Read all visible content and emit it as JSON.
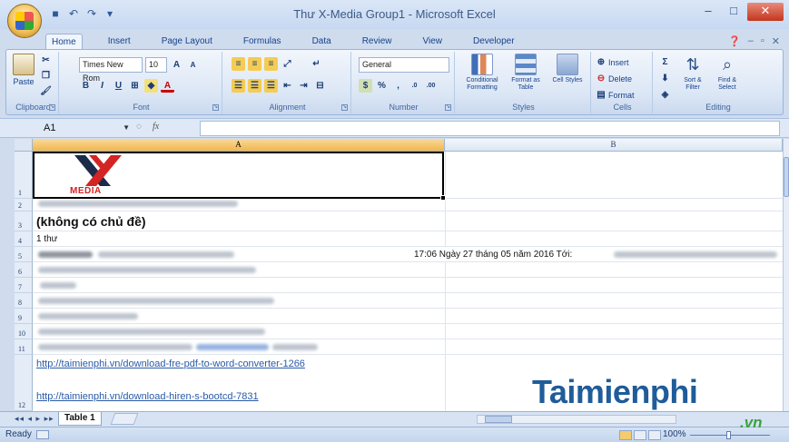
{
  "window": {
    "title": "Thư X-Media Group1 - Microsoft Excel",
    "minimize": "–",
    "maximize": "□",
    "close": "✕"
  },
  "tabs": [
    "Home",
    "Insert",
    "Page Layout",
    "Formulas",
    "Data",
    "Review",
    "View",
    "Developer"
  ],
  "ribbon": {
    "clipboard": {
      "label": "Clipboard",
      "paste": "Paste"
    },
    "font": {
      "label": "Font",
      "font_name": "Times New Rom",
      "font_size": "10",
      "bold": "B",
      "italic": "I",
      "underline": "U"
    },
    "alignment": {
      "label": "Alignment"
    },
    "number": {
      "label": "Number",
      "format": "General",
      "percent": "%",
      "comma": ","
    },
    "styles": {
      "label": "Styles",
      "conditional": "Conditional Formatting",
      "format_table": "Format as Table",
      "cell_styles": "Cell Styles"
    },
    "cells": {
      "label": "Cells",
      "insert": "Insert",
      "delete": "Delete",
      "format": "Format"
    },
    "editing": {
      "label": "Editing",
      "sort": "Sort & Filter",
      "find": "Find & Select"
    }
  },
  "formula_bar": {
    "name_box": "A1",
    "fx": "fx"
  },
  "columns": [
    "A",
    "B"
  ],
  "rows": [
    {
      "num": "1"
    },
    {
      "num": "2"
    },
    {
      "num": "3",
      "text": "(không có chủ đề)"
    },
    {
      "num": "4",
      "text": "1 thư"
    },
    {
      "num": "5",
      "text_b": "17:06 Ngày 27 tháng 05 năm 2016 Tới:"
    },
    {
      "num": "6"
    },
    {
      "num": "7"
    },
    {
      "num": "8"
    },
    {
      "num": "9"
    },
    {
      "num": "10"
    },
    {
      "num": "11"
    },
    {
      "num": "12",
      "link1": "http://taimienphi.vn/download-fre-pdf-to-word-converter-1266",
      "link2": "http://taimienphi.vn/download-hiren-s-bootcd-7831"
    }
  ],
  "logo_text": "MEDIA",
  "sheet": {
    "nav": "◂◂ ◂ ▸ ▸▸",
    "tab": "Table 1"
  },
  "status": {
    "ready": "Ready",
    "zoom": "100%"
  },
  "watermark": {
    "main": "Taimienphi",
    "sub": ".vn"
  },
  "colors": {
    "logo_red": "#d42424",
    "logo_dark": "#1d2b4a",
    "link": "#2a5aa8",
    "watermark": "#1f5c99"
  }
}
